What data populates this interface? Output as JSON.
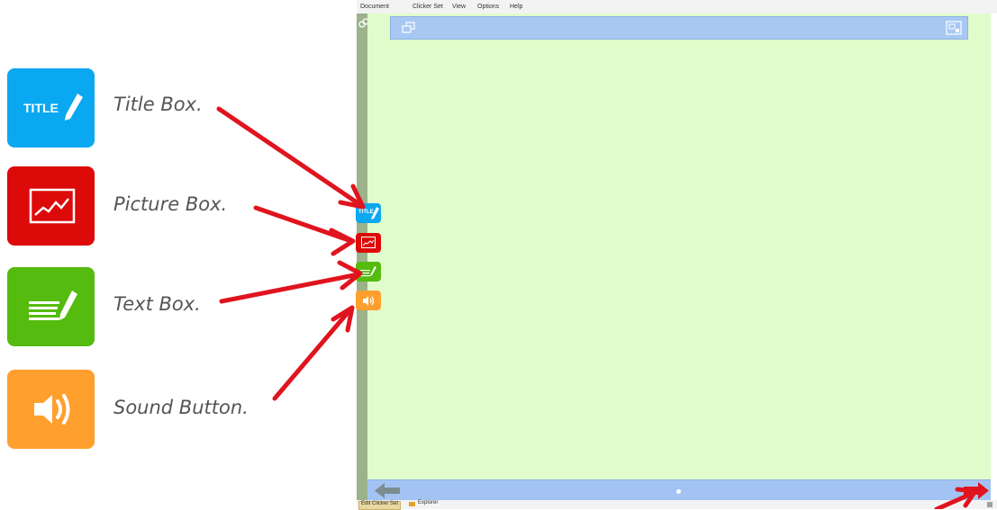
{
  "menu": {
    "items": [
      "Document",
      "Clicker Set",
      "View",
      "Options",
      "Help"
    ]
  },
  "legend": [
    {
      "label": "Title Box.",
      "icon": "title-pencil-icon",
      "color": "#0aa8f0",
      "icon_text": "TITLE"
    },
    {
      "label": "Picture Box.",
      "icon": "picture-icon",
      "color": "#dd0a0a"
    },
    {
      "label": "Text Box.",
      "icon": "text-lines-pencil-icon",
      "color": "#55bb0e"
    },
    {
      "label": "Sound Button.",
      "icon": "speaker-icon",
      "color": "#ff9f2e"
    }
  ],
  "toolbar": {
    "title_tool_text": "TITLE"
  },
  "statusbar": {
    "tabs": [
      "Edit Clicker Set",
      "Explorer"
    ]
  },
  "colors": {
    "canvas": "#e0fccb",
    "bars": "#a8c8f4",
    "arrow": "#e0141e"
  }
}
